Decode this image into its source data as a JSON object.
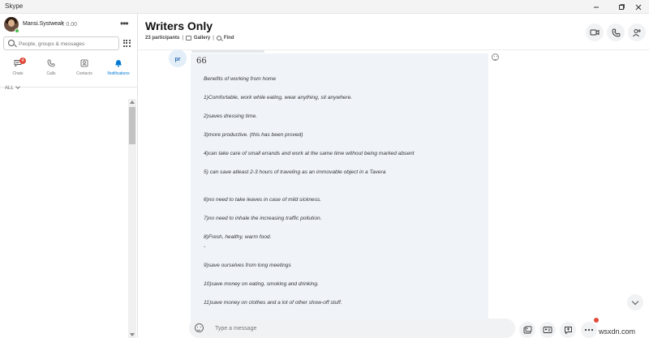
{
  "window": {
    "title": "Skype",
    "controls": [
      "minimize-icon",
      "maximize-icon",
      "close-icon"
    ]
  },
  "profile": {
    "name": "Mansi.Systweak",
    "credit": "₹ 0.00",
    "more_icon": "ellipsis-icon",
    "presence": "online"
  },
  "search": {
    "placeholder": "People, groups & messages",
    "dialpad_icon": "dialpad-icon"
  },
  "nav_tabs": [
    {
      "label": "Chats",
      "icon": "chat-icon",
      "badge": "4"
    },
    {
      "label": "Calls",
      "icon": "phone-icon"
    },
    {
      "label": "Contacts",
      "icon": "contacts-icon"
    },
    {
      "label": "Notifications",
      "icon": "bell-icon",
      "active": true
    }
  ],
  "filter": {
    "label": "ALL"
  },
  "chat": {
    "title": "Writers Only",
    "participants": "23 participants",
    "gallery": "Gallery",
    "find": "Find",
    "separator": "|",
    "header_buttons": [
      "video-call-icon",
      "audio-call-icon",
      "add-person-icon"
    ]
  },
  "message": {
    "sender_initials": "pr",
    "quote_mark": "66",
    "lines": [
      "Benefits of working from home",
      "1)Comfortable, work while eating, wear anything, sit anywhere.",
      "2)saves dressing time.",
      "3)more productive. (this has been proved)",
      "4)can take care of small errands and work at the same time without being marked absent",
      "5) can save atleast 2-3 hours of traveling as an immovable object in a Tavera",
      "6)no need to take leaves in case of mild sickness.",
      "7)no need to inhale the increasing traffic pollution.",
      "8)Fresh, healthy, warm food.",
      "-",
      "9)save ourselves from long meetings",
      "10)save money on eating, smoking and drinking.",
      "11)save money on clothes and a lot of other show-off stuff."
    ]
  },
  "composer": {
    "placeholder": "Type a message",
    "buttons": [
      "emoji-icon",
      "media-gallery-icon",
      "contact-card-icon",
      "file-share-icon",
      "more-options-icon"
    ]
  },
  "watermark": "wsxdn.com",
  "colors": {
    "accent": "#0078d4",
    "bubble": "#f0f4f9",
    "badge": "#e24b3b",
    "presence": "#4bbd4b"
  }
}
